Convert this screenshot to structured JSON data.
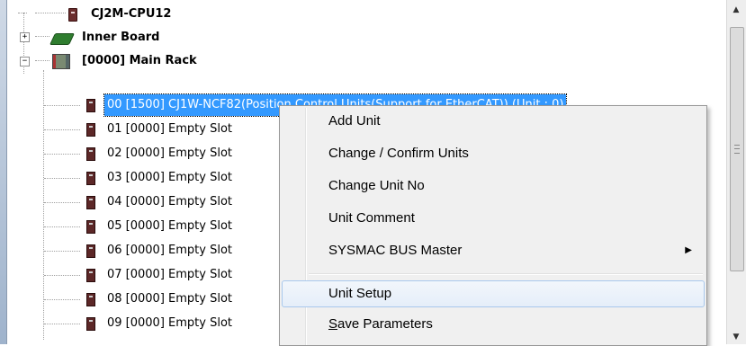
{
  "tree": {
    "cpu": {
      "label": "CJ2M-CPU12"
    },
    "inner_board": {
      "label": "Inner Board",
      "expander": "+"
    },
    "main_rack": {
      "label": "[0000] Main Rack",
      "expander": "−"
    },
    "slots": [
      {
        "label": "00 [1500] CJ1W-NCF82(Position Control Units(Support for EtherCAT)) (Unit : 0)"
      },
      {
        "label": "01 [0000] Empty Slot"
      },
      {
        "label": "02 [0000] Empty Slot"
      },
      {
        "label": "03 [0000] Empty Slot"
      },
      {
        "label": "04 [0000] Empty Slot"
      },
      {
        "label": "05 [0000] Empty Slot"
      },
      {
        "label": "06 [0000] Empty Slot"
      },
      {
        "label": "07 [0000] Empty Slot"
      },
      {
        "label": "08 [0000] Empty Slot"
      },
      {
        "label": "09 [0000] Empty Slot"
      }
    ]
  },
  "context_menu": {
    "items": [
      {
        "label": "Add Unit"
      },
      {
        "label": "Change / Confirm Units"
      },
      {
        "label": "Change Unit No"
      },
      {
        "label": "Unit Comment"
      },
      {
        "label": "SYSMAC BUS Master",
        "submenu_arrow": "▶"
      },
      {
        "label": "Unit Setup"
      },
      {
        "label_accel": "S",
        "label_rest": "ave Parameters"
      }
    ]
  },
  "scrollbar": {
    "up_arrow": "▲",
    "down_arrow": "▼"
  },
  "colors": {
    "selection": "#3399ff",
    "menu_bg": "#f0f0f0",
    "hover_border": "#a8c8ec"
  }
}
